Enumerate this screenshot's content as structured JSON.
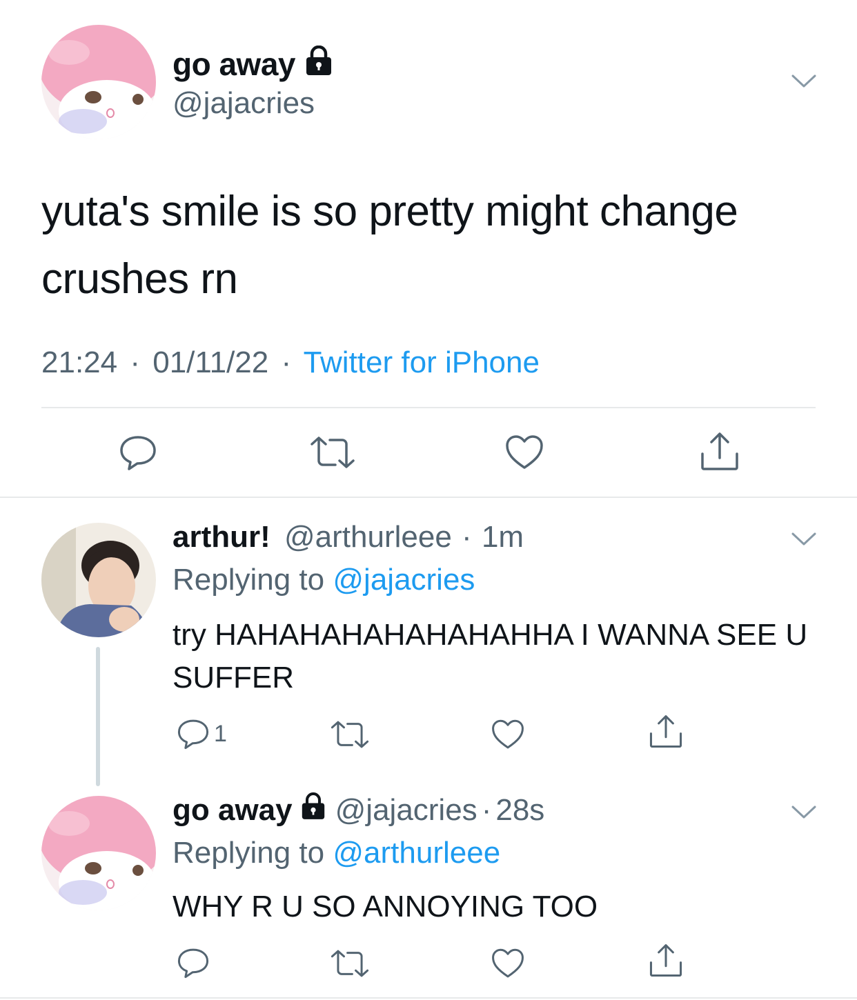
{
  "main_tweet": {
    "display_name": "go away",
    "handle": "@jajacries",
    "text": "yuta's smile is so pretty might change crushes rn",
    "time": "21:24",
    "date": "01/11/22",
    "source": "Twitter for iPhone",
    "sep": "·",
    "icons": [
      "lock-icon",
      "chevron-down-icon",
      "reply-icon",
      "retweet-icon",
      "like-icon",
      "share-icon"
    ]
  },
  "replies": [
    {
      "display_name": "arthur!",
      "handle": "@arthurleee",
      "sep": "·",
      "age": "1m",
      "replying_prefix": "Replying to",
      "replying_to": "@jajacries",
      "text": "try HAHAHAHAHAHAHAHHA I WANNA SEE U SUFFER",
      "reply_count": "1"
    },
    {
      "display_name": "go away",
      "handle": "@jajacries",
      "sep": "·",
      "age": "28s",
      "replying_prefix": "Replying to",
      "replying_to": "@arthurleee",
      "text": "WHY R U SO ANNOYING TOO",
      "reply_count": ""
    }
  ],
  "colors": {
    "text": "#0f1419",
    "secondary": "#536471",
    "link": "#1d9bf0",
    "divider": "#e7e9ea",
    "thread_line": "#cfd9de"
  }
}
